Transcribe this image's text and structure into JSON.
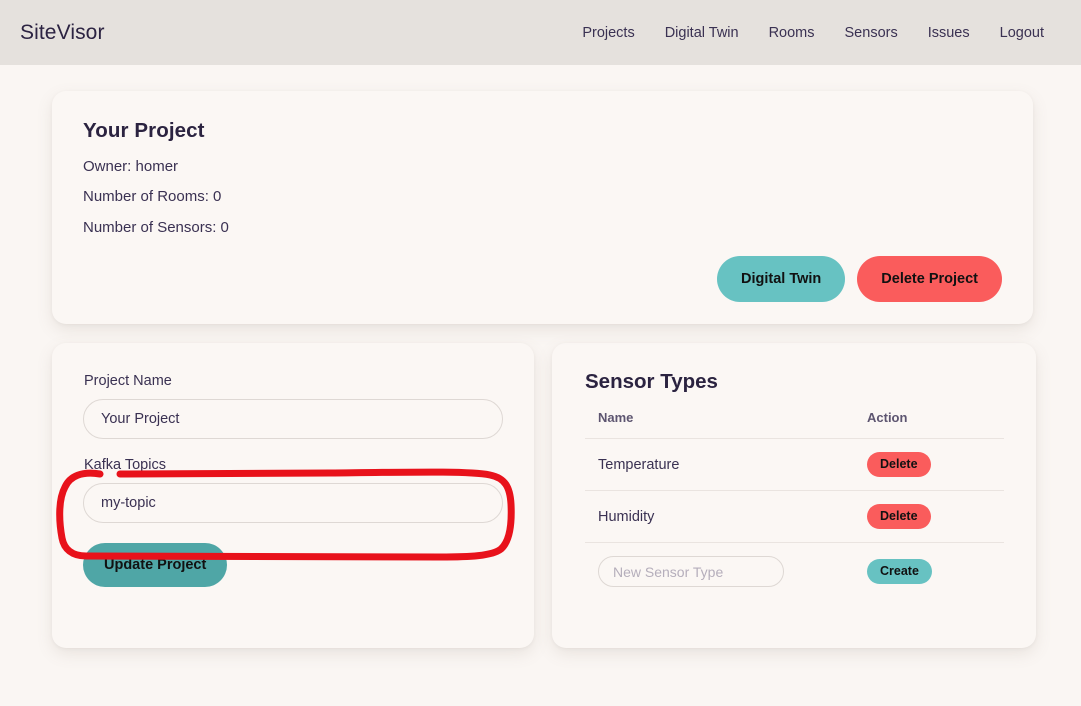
{
  "navbar": {
    "brand": "SiteVisor",
    "links": [
      {
        "label": "Projects"
      },
      {
        "label": "Digital Twin"
      },
      {
        "label": "Rooms"
      },
      {
        "label": "Sensors"
      },
      {
        "label": "Issues"
      },
      {
        "label": "Logout"
      }
    ]
  },
  "project_card": {
    "title": "Your Project",
    "owner_line": "Owner: homer",
    "rooms_line": "Number of Rooms: 0",
    "sensors_line": "Number of Sensors: 0",
    "digital_twin_button": "Digital Twin",
    "delete_project_button": "Delete Project"
  },
  "project_form": {
    "name_label": "Project Name",
    "name_value": "Your Project",
    "name_placeholder": "Project Name",
    "kafka_label": "Kafka Topics",
    "kafka_value": "my-topic",
    "kafka_placeholder": "Kafka Topics",
    "update_button": "Update Project"
  },
  "sensor_types": {
    "title": "Sensor Types",
    "columns": [
      "Name",
      "Action"
    ],
    "rows": [
      {
        "name": "Temperature",
        "action": "Delete"
      },
      {
        "name": "Humidity",
        "action": "Delete"
      }
    ],
    "new_type_placeholder": "New Sensor Type",
    "new_type_value": "",
    "create_button": "Create"
  },
  "annotation": {
    "type": "hand-drawn-rounded-rectangle",
    "color": "#e8121b",
    "target": "Kafka Topics field group"
  },
  "colors": {
    "page_background": "#faf6f3",
    "navbar_background": "#e5e1dd",
    "card_background": "#fbf7f4",
    "teal": "#67c2c2",
    "teal_dark": "#4fa6a6",
    "red": "#fa5c5c",
    "text_dark": "#2b2340",
    "annotation_red": "#e8121b"
  }
}
